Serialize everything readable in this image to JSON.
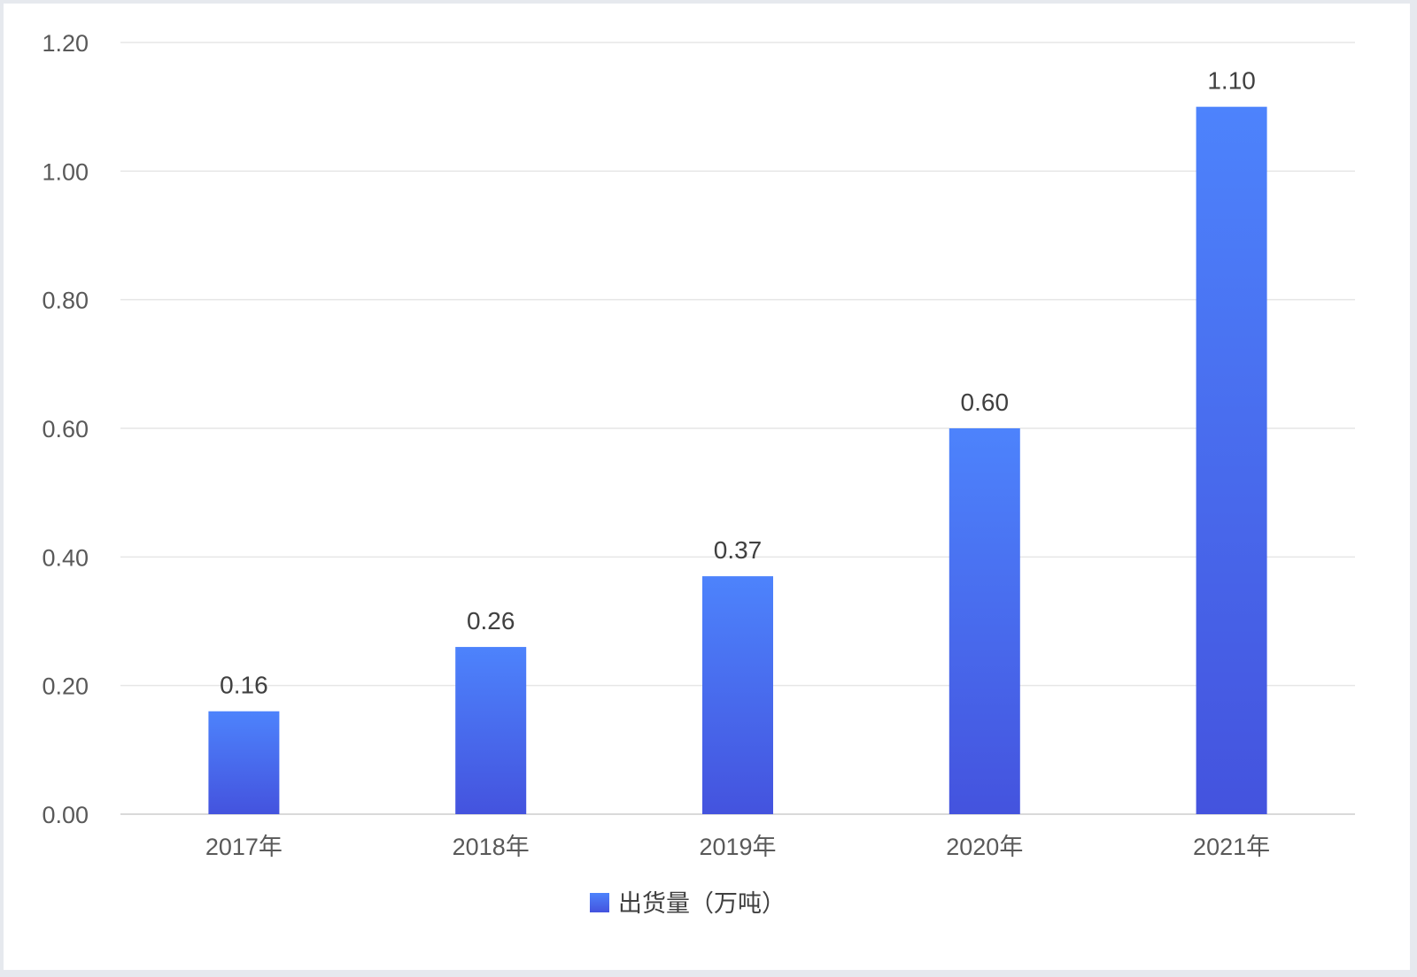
{
  "chart_data": {
    "type": "bar",
    "categories": [
      "2017年",
      "2018年",
      "2019年",
      "2020年",
      "2021年"
    ],
    "series": [
      {
        "name": "出货量（万吨）",
        "values": [
          0.16,
          0.26,
          0.37,
          0.6,
          1.1
        ]
      }
    ],
    "data_labels": [
      "0.16",
      "0.26",
      "0.37",
      "0.60",
      "1.10"
    ],
    "y_ticks": [
      "0.00",
      "0.20",
      "0.40",
      "0.60",
      "0.80",
      "1.00",
      "1.20"
    ],
    "ylim": [
      0,
      1.2
    ],
    "grid": true,
    "legend_position": "bottom-center",
    "colors": {
      "bar_top": "#4d83fc",
      "bar_bottom": "#4453de",
      "grid": "#e6e6e6",
      "axis": "#d9d9d9"
    }
  }
}
